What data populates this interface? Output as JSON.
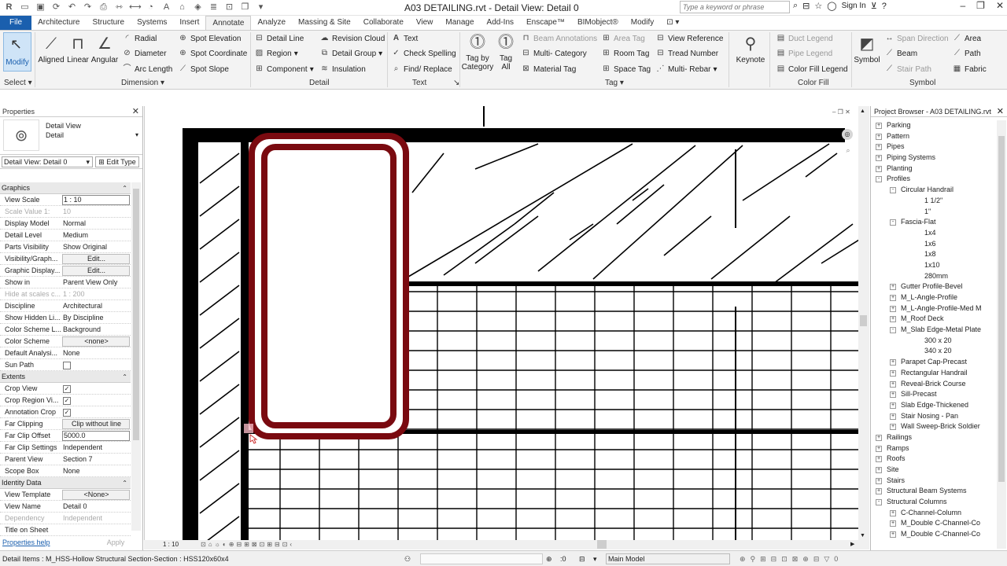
{
  "app": {
    "title": "A03 DETAILING.rvt - Detail View: Detail 0",
    "search_placeholder": "Type a keyword or phrase",
    "sign_in": "Sign In"
  },
  "ribbon_tabs": [
    "File",
    "Architecture",
    "Structure",
    "Systems",
    "Insert",
    "Annotate",
    "Analyze",
    "Massing & Site",
    "Collaborate",
    "View",
    "Manage",
    "Add-Ins",
    "Enscape™",
    "BIMobject®",
    "Modify"
  ],
  "active_tab": "Annotate",
  "ribbon": {
    "select": {
      "modify": "Modify",
      "label": "Select"
    },
    "dimension": {
      "aligned": "Aligned",
      "linear": "Linear",
      "angular": "Angular",
      "radial": "Radial",
      "diameter": "Diameter",
      "arc_length": "Arc Length",
      "spot_elevation": "Spot Elevation",
      "spot_coordinate": "Spot Coordinate",
      "spot_slope": "Spot Slope",
      "label": "Dimension"
    },
    "detail": {
      "detail_line": "Detail Line",
      "region": "Region",
      "component": "Component",
      "revision_cloud": "Revision Cloud",
      "detail_group": "Detail Group",
      "insulation": "Insulation",
      "label": "Detail"
    },
    "text": {
      "text": "Text",
      "check_spelling": "Check Spelling",
      "find_replace": "Find/ Replace",
      "label": "Text"
    },
    "tag": {
      "tag_by_category": "Tag by Category",
      "tag_all": "Tag All",
      "beam_annotations": "Beam Annotations",
      "multi_category": "Multi- Category",
      "material_tag": "Material Tag",
      "area_tag": "Area Tag",
      "room_tag": "Room Tag",
      "space_tag": "Space Tag",
      "view_reference": "View Reference",
      "tread_number": "Tread Number",
      "multi_rebar": "Multi- Rebar",
      "keynote": "Keynote",
      "label": "Tag"
    },
    "color_fill": {
      "duct_legend": "Duct Legend",
      "pipe_legend": "Pipe Legend",
      "color_fill_legend": "Color Fill Legend",
      "label": "Color Fill"
    },
    "symbol": {
      "symbol": "Symbol",
      "span_direction": "Span Direction",
      "beam": "Beam",
      "stair_path": "Stair Path",
      "area": "Area",
      "path": "Path",
      "fabric": "Fabric",
      "label": "Symbol"
    }
  },
  "properties": {
    "title": "Properties",
    "type_name": [
      "Detail View",
      "Detail"
    ],
    "instance_selector": "Detail View: Detail 0",
    "edit_type": "Edit Type",
    "groups": [
      {
        "name": "Graphics",
        "rows": [
          {
            "k": "View Scale",
            "v": "1 : 10",
            "style": "box"
          },
          {
            "k": "Scale Value   1:",
            "v": "10",
            "disabled": true
          },
          {
            "k": "Display Model",
            "v": "Normal"
          },
          {
            "k": "Detail Level",
            "v": "Medium"
          },
          {
            "k": "Parts Visibility",
            "v": "Show Original"
          },
          {
            "k": "Visibility/Graph...",
            "v": "Edit...",
            "style": "btn"
          },
          {
            "k": "Graphic Display...",
            "v": "Edit...",
            "style": "btn"
          },
          {
            "k": "Show in",
            "v": "Parent View Only"
          },
          {
            "k": "Hide at scales c...",
            "v": "1 : 200",
            "disabled": true
          },
          {
            "k": "Discipline",
            "v": "Architectural"
          },
          {
            "k": "Show Hidden Li...",
            "v": "By Discipline"
          },
          {
            "k": "Color Scheme L...",
            "v": "Background"
          },
          {
            "k": "Color Scheme",
            "v": "<none>",
            "style": "btn"
          },
          {
            "k": "Default Analysi...",
            "v": "None"
          },
          {
            "k": "Sun Path",
            "check": false
          }
        ]
      },
      {
        "name": "Extents",
        "rows": [
          {
            "k": "Crop View",
            "check": true
          },
          {
            "k": "Crop Region Vi...",
            "check": true
          },
          {
            "k": "Annotation Crop",
            "check": true
          },
          {
            "k": "Far Clipping",
            "v": "Clip without line",
            "style": "btn"
          },
          {
            "k": "Far Clip Offset",
            "v": "5000.0",
            "style": "box"
          },
          {
            "k": "Far Clip Settings",
            "v": "Independent"
          },
          {
            "k": "Parent View",
            "v": "Section 7"
          },
          {
            "k": "Scope Box",
            "v": "None"
          }
        ]
      },
      {
        "name": "Identity Data",
        "rows": [
          {
            "k": "View Template",
            "v": "<None>",
            "style": "btn"
          },
          {
            "k": "View Name",
            "v": "Detail 0"
          },
          {
            "k": "Dependency",
            "v": "Independent",
            "disabled": true
          },
          {
            "k": "Title on Sheet",
            "v": ""
          }
        ]
      }
    ],
    "help_link": "Properties help",
    "apply": "Apply"
  },
  "canvas": {
    "scale_label": "1 : 10",
    "colors": {
      "hss": "#7a0a10",
      "line": "#000000",
      "grid": "#555555",
      "highlight": "#f4b6c2"
    }
  },
  "browser": {
    "title": "Project Browser - A03 DETAILING.rvt",
    "items": [
      {
        "label": "Parking",
        "level": 1,
        "ex": "+"
      },
      {
        "label": "Pattern",
        "level": 1,
        "ex": "+"
      },
      {
        "label": "Pipes",
        "level": 1,
        "ex": "+"
      },
      {
        "label": "Piping Systems",
        "level": 1,
        "ex": "+"
      },
      {
        "label": "Planting",
        "level": 1,
        "ex": "+"
      },
      {
        "label": "Profiles",
        "level": 1,
        "ex": "-"
      },
      {
        "label": "Circular Handrail",
        "level": 2,
        "ex": "-"
      },
      {
        "label": "1 1/2\"",
        "level": 3
      },
      {
        "label": "1\"",
        "level": 3
      },
      {
        "label": "Fascia-Flat",
        "level": 2,
        "ex": "-"
      },
      {
        "label": "1x4",
        "level": 3
      },
      {
        "label": "1x6",
        "level": 3
      },
      {
        "label": "1x8",
        "level": 3
      },
      {
        "label": "1x10",
        "level": 3
      },
      {
        "label": "280mm",
        "level": 3
      },
      {
        "label": "Gutter Profile-Bevel",
        "level": 2,
        "ex": "+"
      },
      {
        "label": "M_L-Angle-Profile",
        "level": 2,
        "ex": "+"
      },
      {
        "label": "M_L-Angle-Profile-Med M",
        "level": 2,
        "ex": "+"
      },
      {
        "label": "M_Roof Deck",
        "level": 2,
        "ex": "+"
      },
      {
        "label": "M_Slab Edge-Metal Plate",
        "level": 2,
        "ex": "-"
      },
      {
        "label": "300 x 20",
        "level": 3
      },
      {
        "label": "340 x 20",
        "level": 3
      },
      {
        "label": "Parapet Cap-Precast",
        "level": 2,
        "ex": "+"
      },
      {
        "label": "Rectangular Handrail",
        "level": 2,
        "ex": "+"
      },
      {
        "label": "Reveal-Brick Course",
        "level": 2,
        "ex": "+"
      },
      {
        "label": "Sill-Precast",
        "level": 2,
        "ex": "+"
      },
      {
        "label": "Slab Edge-Thickened",
        "level": 2,
        "ex": "+"
      },
      {
        "label": "Stair Nosing - Pan",
        "level": 2,
        "ex": "+"
      },
      {
        "label": "Wall Sweep-Brick Soldier",
        "level": 2,
        "ex": "+"
      },
      {
        "label": "Railings",
        "level": 1,
        "ex": "+"
      },
      {
        "label": "Ramps",
        "level": 1,
        "ex": "+"
      },
      {
        "label": "Roofs",
        "level": 1,
        "ex": "+"
      },
      {
        "label": "Site",
        "level": 1,
        "ex": "+"
      },
      {
        "label": "Stairs",
        "level": 1,
        "ex": "+"
      },
      {
        "label": "Structural Beam Systems",
        "level": 1,
        "ex": "+"
      },
      {
        "label": "Structural Columns",
        "level": 1,
        "ex": "-"
      },
      {
        "label": "C-Channel-Column",
        "level": 2,
        "ex": "+"
      },
      {
        "label": "M_Double C-Channel-Co",
        "level": 2,
        "ex": "+"
      },
      {
        "label": "M_Double C-Channel-Co",
        "level": 2,
        "ex": "+"
      }
    ]
  },
  "statusbar": {
    "message": "Detail Items : M_HSS-Hollow Structural Section-Section : HSS120x60x4",
    "zero": ":0",
    "model": "Main Model"
  }
}
